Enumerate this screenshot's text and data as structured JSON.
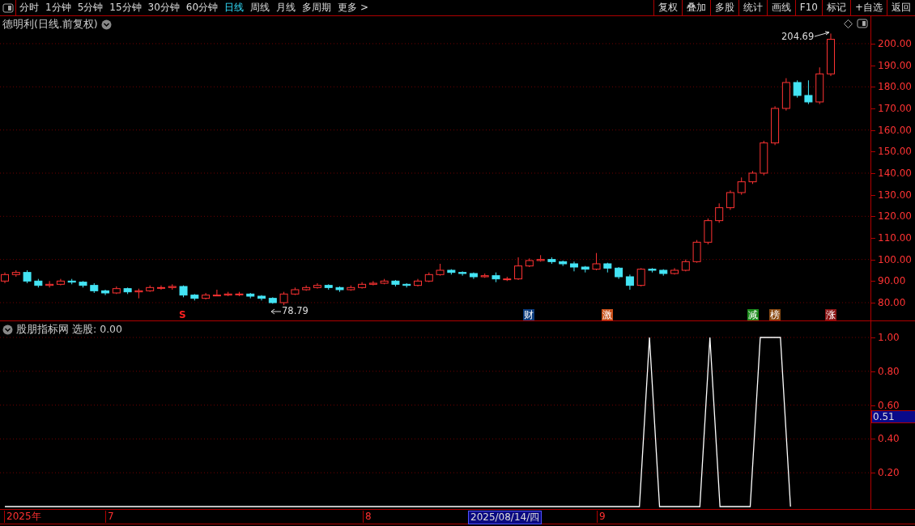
{
  "toolbar": {
    "periods": [
      {
        "label": "分时",
        "selected": false
      },
      {
        "label": "1分钟",
        "selected": false
      },
      {
        "label": "5分钟",
        "selected": false
      },
      {
        "label": "15分钟",
        "selected": false
      },
      {
        "label": "30分钟",
        "selected": false
      },
      {
        "label": "60分钟",
        "selected": false
      },
      {
        "label": "日线",
        "selected": true
      },
      {
        "label": "周线",
        "selected": false
      },
      {
        "label": "月线",
        "selected": false
      },
      {
        "label": "多周期",
        "selected": false
      },
      {
        "label": "更多 >",
        "selected": false
      }
    ],
    "actions": [
      "复权",
      "叠加",
      "多股",
      "统计",
      "画线",
      "F10",
      "标记",
      "+自选",
      "返回"
    ]
  },
  "price_panel": {
    "title": "德明利(日线.前复权)",
    "high_label": "204.69",
    "low_label": "78.79",
    "chart_data": {
      "type": "candlestick",
      "grid": true,
      "ylim": [
        71.75,
        212.73
      ],
      "yticks": [
        {
          "value": 80,
          "label": "80.00"
        },
        {
          "value": 90,
          "label": "90.00"
        },
        {
          "value": 100,
          "label": "100.00"
        },
        {
          "value": 110,
          "label": "110.00"
        },
        {
          "value": 120,
          "label": "120.00"
        },
        {
          "value": 130,
          "label": "130.00"
        },
        {
          "value": 140,
          "label": "140.00"
        },
        {
          "value": 150,
          "label": "150.00"
        },
        {
          "value": 160,
          "label": "160.00"
        },
        {
          "value": 170,
          "label": "170.00"
        },
        {
          "value": 180,
          "label": "180.00"
        },
        {
          "value": 190,
          "label": "190.00"
        },
        {
          "value": 200,
          "label": "200.00"
        }
      ],
      "ohlc": [
        [
          90,
          94,
          89,
          93
        ],
        [
          93,
          95,
          92,
          94
        ],
        [
          94,
          95,
          89,
          90
        ],
        [
          90,
          91,
          87,
          88
        ],
        [
          88,
          90,
          87,
          88.5
        ],
        [
          88.5,
          91,
          88,
          90
        ],
        [
          90,
          91,
          88.5,
          89.5
        ],
        [
          89.5,
          90,
          87,
          88
        ],
        [
          88,
          89,
          84.5,
          85.5
        ],
        [
          85.5,
          86,
          83.5,
          84.5
        ],
        [
          84.5,
          87.5,
          84,
          86.5
        ],
        [
          86.5,
          87,
          84,
          85
        ],
        [
          85,
          86.5,
          82,
          85.5
        ],
        [
          85.5,
          88,
          85,
          87
        ],
        [
          87,
          88,
          86,
          87
        ],
        [
          87,
          88.5,
          86,
          87.5
        ],
        [
          87.5,
          88,
          82.5,
          83.5
        ],
        [
          83.5,
          84,
          81,
          82
        ],
        [
          82,
          84.5,
          81.5,
          83.5
        ],
        [
          83.5,
          86,
          83,
          83.5
        ],
        [
          83.5,
          85,
          83,
          84
        ],
        [
          84,
          85,
          83,
          84
        ],
        [
          84,
          84.5,
          82,
          83
        ],
        [
          83,
          83.5,
          81,
          82
        ],
        [
          82,
          82.5,
          79.5,
          80
        ],
        [
          80,
          85,
          78.79,
          84
        ],
        [
          84,
          87,
          83.5,
          86
        ],
        [
          86,
          88,
          85.5,
          87
        ],
        [
          87,
          89,
          86.5,
          88
        ],
        [
          88,
          88.5,
          86,
          87
        ],
        [
          87,
          87.5,
          85,
          86
        ],
        [
          86,
          88,
          85.5,
          87
        ],
        [
          87,
          89.5,
          86.5,
          88.5
        ],
        [
          88.5,
          90,
          88,
          89
        ],
        [
          89,
          91,
          88.5,
          90
        ],
        [
          90,
          90.5,
          87.5,
          88.5
        ],
        [
          88.5,
          89,
          87,
          88
        ],
        [
          88,
          91,
          87.5,
          90
        ],
        [
          90,
          94,
          89.5,
          93
        ],
        [
          93,
          98,
          92.5,
          95
        ],
        [
          95,
          95.5,
          93,
          94
        ],
        [
          94,
          94.5,
          92.5,
          93.5
        ],
        [
          93.5,
          94,
          91,
          92
        ],
        [
          92,
          93.5,
          91.5,
          92.5
        ],
        [
          92.5,
          94,
          89.5,
          91
        ],
        [
          91,
          92,
          90,
          91
        ],
        [
          91,
          101,
          90.5,
          97
        ],
        [
          97,
          100.5,
          96.5,
          99.5
        ],
        [
          99.5,
          102,
          99,
          100
        ],
        [
          100,
          101,
          98,
          99
        ],
        [
          99,
          99.5,
          97,
          98
        ],
        [
          98,
          99,
          94.5,
          96.5
        ],
        [
          96.5,
          97,
          94,
          95.5
        ],
        [
          95.5,
          103,
          95,
          98
        ],
        [
          98,
          98.5,
          94,
          96
        ],
        [
          96,
          96.5,
          91,
          92
        ],
        [
          92,
          93,
          86,
          88
        ],
        [
          88,
          96,
          87.5,
          95.5
        ],
        [
          95.5,
          96,
          94,
          95
        ],
        [
          95,
          95.5,
          92.5,
          93.5
        ],
        [
          93.5,
          96,
          93,
          95
        ],
        [
          95,
          100,
          94.5,
          99
        ],
        [
          99,
          109,
          98.5,
          108
        ],
        [
          108,
          119,
          107,
          118
        ],
        [
          118,
          126,
          117,
          124
        ],
        [
          124,
          132,
          123,
          131
        ],
        [
          131,
          138,
          130,
          136
        ],
        [
          136,
          141,
          135,
          140
        ],
        [
          140,
          155,
          139,
          154
        ],
        [
          154,
          171,
          153,
          170
        ],
        [
          170,
          184,
          169,
          182
        ],
        [
          182,
          183,
          175,
          176
        ],
        [
          176,
          183,
          172,
          173
        ],
        [
          173,
          189,
          172,
          186
        ],
        [
          186,
          204.69,
          185,
          202
        ]
      ]
    },
    "markers": [
      {
        "text": "S",
        "kind": "text",
        "color": "#ff2020"
      },
      {
        "text": "财",
        "kind": "tag",
        "color": "#0b3b7c"
      },
      {
        "text": "激",
        "kind": "tag",
        "color": "#c8501a"
      },
      {
        "text": "减",
        "kind": "tag",
        "color": "#1a8a1a"
      },
      {
        "text": "榜",
        "kind": "tag",
        "color": "#8a4a12"
      },
      {
        "text": "涨",
        "kind": "tag",
        "color": "#8a1414"
      }
    ]
  },
  "indicator_panel": {
    "name": "股朋指标网",
    "reading": "选股: 0.00",
    "cursor_value": "0.51",
    "chart_data": {
      "type": "line",
      "grid": true,
      "ylim": [
        -0.01435,
        1
      ],
      "yticks": [
        {
          "value": 0.2,
          "label": "0.20"
        },
        {
          "value": 0.4,
          "label": "0.40"
        },
        {
          "value": 0.6,
          "label": "0.60"
        },
        {
          "value": 0.8,
          "label": "0.80"
        },
        {
          "value": 1,
          "label": "1.00"
        }
      ],
      "series": [
        {
          "color": "#ffffff",
          "values": [
            0,
            0,
            0,
            0,
            0,
            0,
            0,
            0,
            0,
            0,
            0,
            0,
            0,
            0,
            0,
            0,
            0,
            0,
            0,
            0,
            0,
            0,
            0,
            0,
            0,
            0,
            0,
            0,
            0,
            0,
            0,
            0,
            0,
            0,
            0,
            0,
            0,
            0,
            0,
            0,
            0,
            0,
            0,
            0,
            0,
            0,
            0,
            0,
            0,
            0,
            0,
            0,
            0,
            0,
            0,
            0,
            0,
            0,
            0,
            0,
            0,
            0,
            0,
            0,
            1,
            0,
            0,
            0,
            0,
            0,
            1,
            0,
            0,
            0,
            0,
            1,
            1,
            1,
            0
          ]
        }
      ]
    }
  },
  "time_axis": [
    {
      "label": "2025年",
      "selected": false
    },
    {
      "label": "7",
      "selected": false
    },
    {
      "label": "8",
      "selected": false
    },
    {
      "label": "2025/08/14/四",
      "selected": true
    },
    {
      "label": "9",
      "selected": false
    }
  ]
}
